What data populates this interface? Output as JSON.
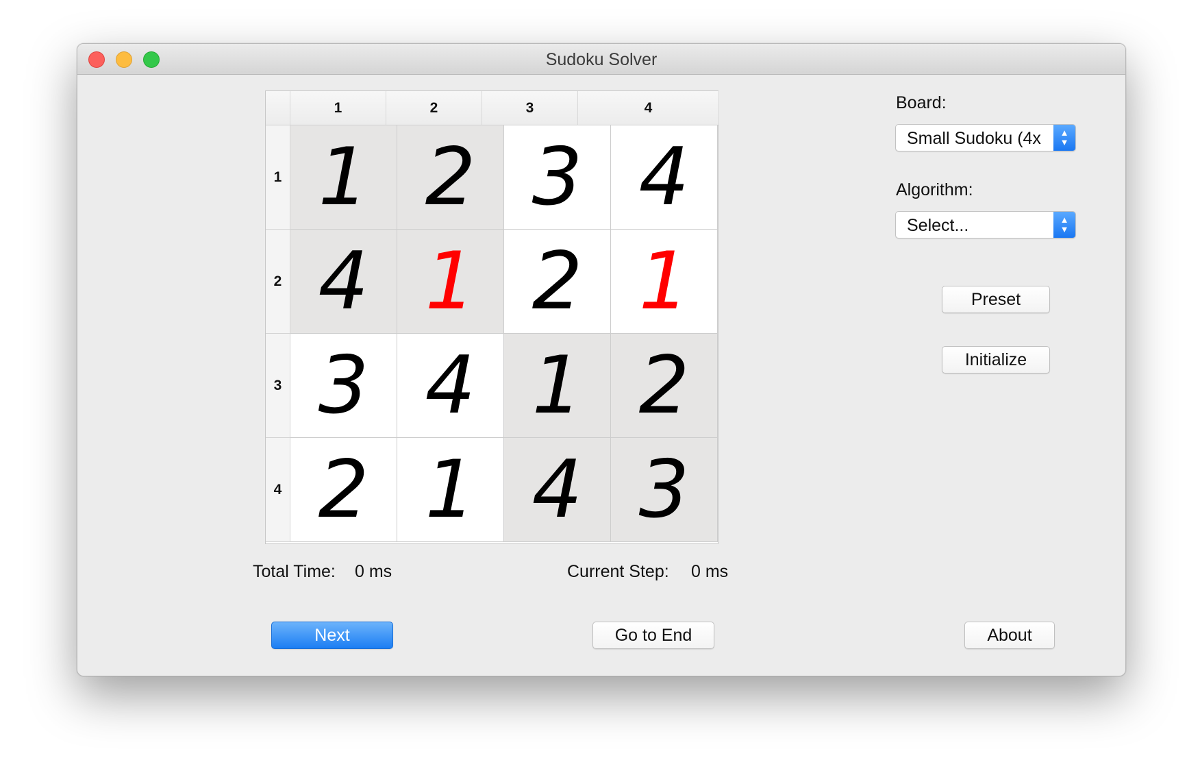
{
  "window": {
    "title": "Sudoku Solver"
  },
  "grid": {
    "columns": [
      "1",
      "2",
      "3",
      "4"
    ],
    "rows": [
      "1",
      "2",
      "3",
      "4"
    ],
    "cells": [
      [
        {
          "value": "1",
          "red": false
        },
        {
          "value": "2",
          "red": false
        },
        {
          "value": "3",
          "red": false
        },
        {
          "value": "4",
          "red": false
        }
      ],
      [
        {
          "value": "4",
          "red": false
        },
        {
          "value": "1",
          "red": true
        },
        {
          "value": "2",
          "red": false
        },
        {
          "value": "1",
          "red": true
        }
      ],
      [
        {
          "value": "3",
          "red": false
        },
        {
          "value": "4",
          "red": false
        },
        {
          "value": "1",
          "red": false
        },
        {
          "value": "2",
          "red": false
        }
      ],
      [
        {
          "value": "2",
          "red": false
        },
        {
          "value": "1",
          "red": false
        },
        {
          "value": "4",
          "red": false
        },
        {
          "value": "3",
          "red": false
        }
      ]
    ],
    "colors": {
      "shaded": "#e6e5e4",
      "white": "#ffffff",
      "highlight_digit": "#ff0000"
    }
  },
  "status": {
    "total_time_label": "Total Time:",
    "total_time_value": "0 ms",
    "current_step_label": "Current Step:",
    "current_step_value": "0 ms"
  },
  "panel": {
    "board_label": "Board:",
    "board_value": "Small Sudoku (4x",
    "algorithm_label": "Algorithm:",
    "algorithm_value": "Select...",
    "preset_label": "Preset",
    "initialize_label": "Initialize"
  },
  "footer": {
    "next_label": "Next",
    "go_to_end_label": "Go to End",
    "about_label": "About"
  },
  "icons": {
    "popup_arrows": "up-down-chevron-icon"
  }
}
